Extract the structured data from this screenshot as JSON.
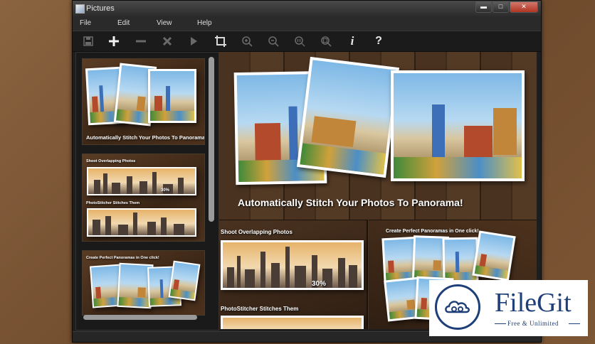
{
  "window": {
    "title": "Pictures"
  },
  "menu": [
    "File",
    "Edit",
    "View",
    "Help"
  ],
  "toolbar": [
    {
      "icon": "save-icon",
      "enabled": false
    },
    {
      "icon": "add-icon",
      "enabled": true
    },
    {
      "icon": "remove-icon",
      "enabled": false
    },
    {
      "icon": "delete-icon",
      "enabled": false
    },
    {
      "icon": "play-icon",
      "enabled": false
    },
    {
      "icon": "crop-icon",
      "enabled": true
    },
    {
      "icon": "zoom-in-icon",
      "enabled": false
    },
    {
      "icon": "zoom-out-icon",
      "enabled": false
    },
    {
      "icon": "actual-size-icon",
      "enabled": false
    },
    {
      "icon": "fit-to-window-icon",
      "enabled": false
    },
    {
      "icon": "info-icon",
      "enabled": true
    },
    {
      "icon": "help-icon",
      "enabled": true
    }
  ],
  "thumbnails": [
    {
      "caption": "Automatically Stitch Your Photos To Panorama!"
    },
    {
      "caption1": "Shoot Overlapping Photos",
      "overlap": "30%",
      "caption2": "PhotoStitcher Stitches Them"
    },
    {
      "caption": "Create Perfect Panoramas in One click!"
    }
  ],
  "preview": {
    "headline": "Automatically Stitch Your Photos To Panorama!",
    "left_caption": "Shoot Overlapping Photos",
    "overlap": "30%",
    "left_caption2": "PhotoStitcher Stitches Them",
    "right_caption": "Create Perfect Panoramas in One click!"
  },
  "watermark": {
    "name": "FileGit",
    "tagline": "Free & Unlimited"
  },
  "colors": {
    "brand": "#1e3f78",
    "window_bg": "#1e1e1e",
    "close_button": "#c2412f"
  }
}
